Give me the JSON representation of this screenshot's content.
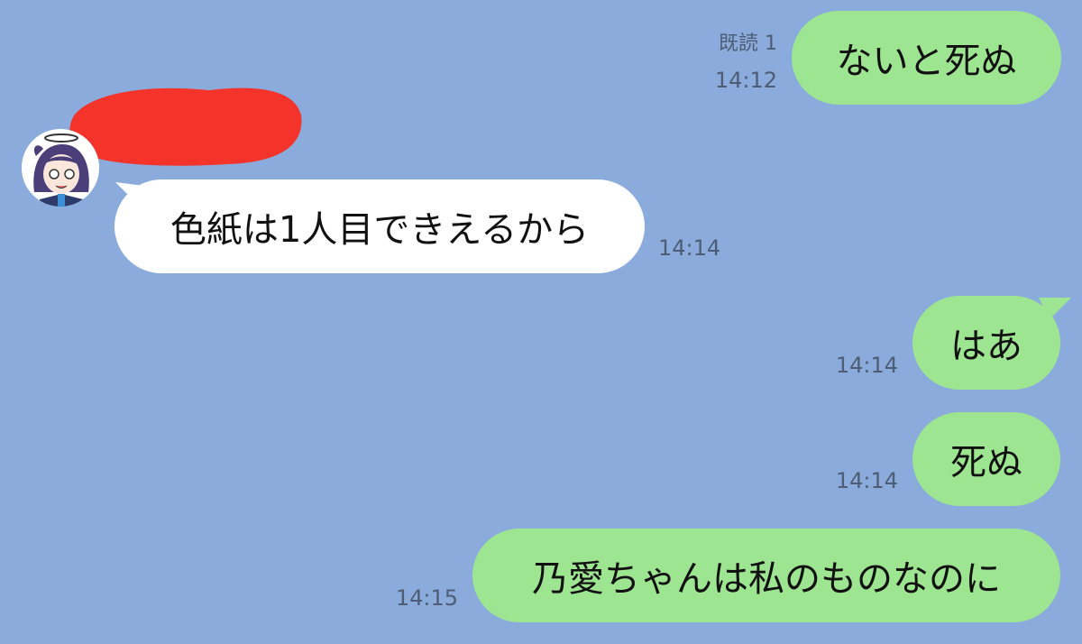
{
  "theme": {
    "background": "#8aabdb",
    "outgoing_bubble": "#9ee592",
    "incoming_bubble": "#ffffff",
    "redaction": "#f4342a",
    "meta_text": "#4e5d74"
  },
  "messages": [
    {
      "direction": "outgoing",
      "text": "ないと死ぬ",
      "read_label": "既読 1",
      "time": "14:12"
    },
    {
      "direction": "incoming",
      "text": "色紙は1人目できえるから",
      "time": "14:14",
      "sender_icon": "anime-girl-avatar-icon"
    },
    {
      "direction": "outgoing",
      "text": "はあ",
      "time": "14:14"
    },
    {
      "direction": "outgoing",
      "text": "死ぬ",
      "time": "14:14"
    },
    {
      "direction": "outgoing",
      "text": "乃愛ちゃんは私のものなのに",
      "time": "14:15"
    }
  ]
}
